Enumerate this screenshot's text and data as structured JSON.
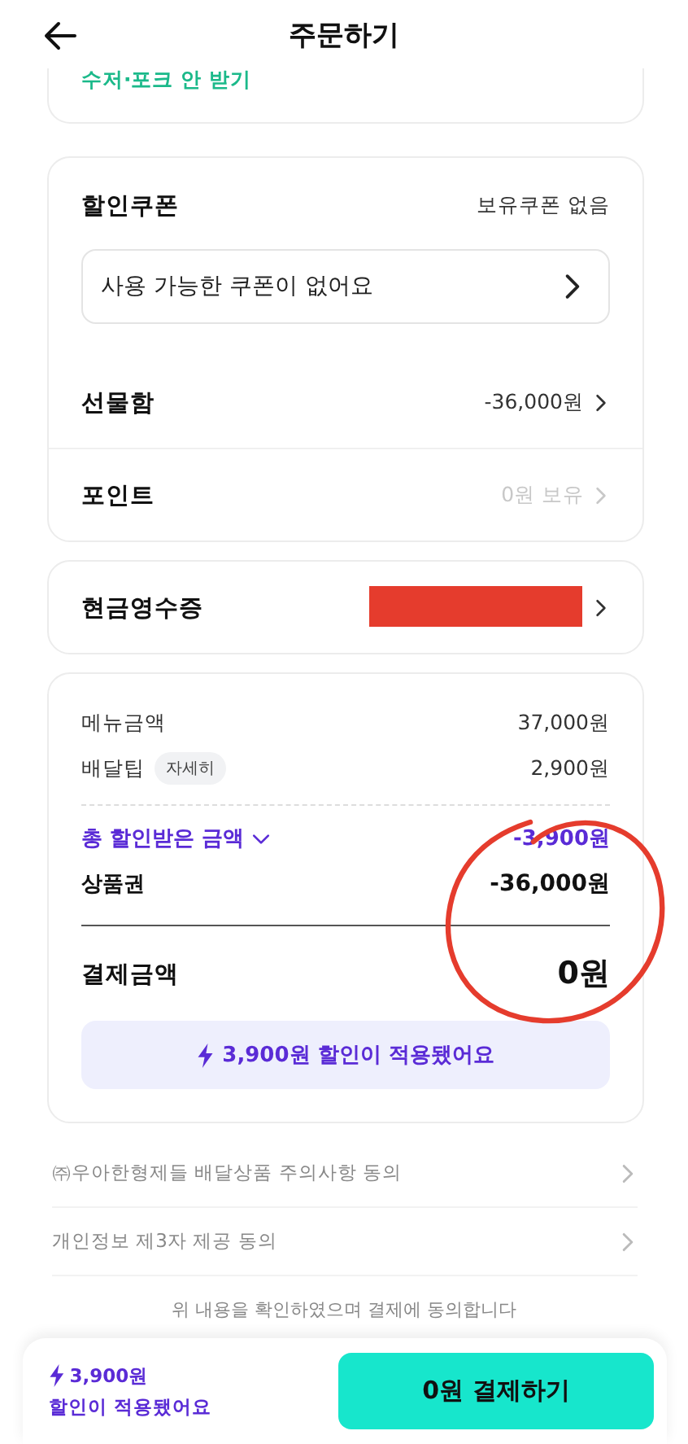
{
  "header": {
    "title": "주문하기"
  },
  "cutlery_option": {
    "label": "수저·포크 안 받기"
  },
  "coupon": {
    "label": "할인쿠폰",
    "status": "보유쿠폰 없음",
    "field_text": "사용 가능한 쿠폰이 없어요"
  },
  "benefit_rows": [
    {
      "label": "선물함",
      "value": "-36,000원",
      "disabled": false
    },
    {
      "label": "포인트",
      "value": "0원 보유",
      "disabled": true
    }
  ],
  "cash_receipt": {
    "label": "현금영수증"
  },
  "summary": {
    "lines": [
      {
        "label": "메뉴금액",
        "value": "37,000원"
      },
      {
        "label": "배달팁",
        "tag": "자세히",
        "value": "2,900원"
      }
    ],
    "discount": {
      "label": "총 할인받은 금액",
      "value": "-3,900원",
      "expanded": false
    },
    "deductions": [
      {
        "label": "상품권",
        "value": "-36,000원"
      }
    ],
    "total": {
      "label": "결제금액",
      "value": "0원"
    },
    "banner": "3,900원 할인이 적용됐어요"
  },
  "agreements": [
    {
      "label": "㈜우아한형제들 배달상품 주의사항 동의"
    },
    {
      "label": "개인정보 제3자 제공 동의"
    }
  ],
  "consent_note": "위 내용을 확인하였으며 결제에 동의합니다",
  "bottom_bar": {
    "saving_amount": "3,900원",
    "saving_note": "할인이 적용됐어요",
    "pay_button": "0원 결제하기"
  }
}
